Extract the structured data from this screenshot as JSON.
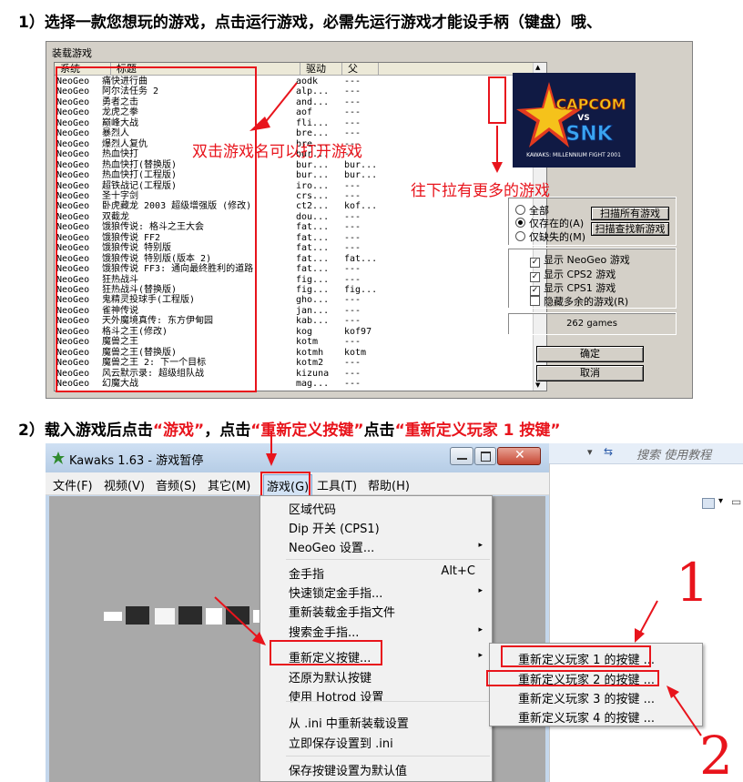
{
  "step1": {
    "number": "1）",
    "text": "选择一款您想玩的游戏，点击运行游戏，必需先运行游戏才能设手柄（键盘）哦、"
  },
  "loader": {
    "title": "装载游戏",
    "columns": {
      "system": "系统",
      "title": "标题",
      "driver": "驱动",
      "parent": "父"
    },
    "games": [
      {
        "system": "NeoGeo",
        "title": "痛快进行曲",
        "driver": "aodk",
        "parent": "---"
      },
      {
        "system": "NeoGeo",
        "title": "阿尔法任务 2",
        "driver": "alp...",
        "parent": "---"
      },
      {
        "system": "NeoGeo",
        "title": "勇者之击",
        "driver": "and...",
        "parent": "---"
      },
      {
        "system": "NeoGeo",
        "title": "龙虎之拳",
        "driver": "aof",
        "parent": "---"
      },
      {
        "system": "NeoGeo",
        "title": "巅峰大战",
        "driver": "fli...",
        "parent": "---"
      },
      {
        "system": "NeoGeo",
        "title": "暴烈人",
        "driver": "bre...",
        "parent": "---"
      },
      {
        "system": "NeoGeo",
        "title": "爆烈人复仇",
        "driver": "bre...",
        "parent": "---"
      },
      {
        "system": "NeoGeo",
        "title": "热血快打",
        "driver": "bur...",
        "parent": "---"
      },
      {
        "system": "NeoGeo",
        "title": "热血快打(替换版)",
        "driver": "bur...",
        "parent": "bur..."
      },
      {
        "system": "NeoGeo",
        "title": "热血快打(工程版)",
        "driver": "bur...",
        "parent": "bur..."
      },
      {
        "system": "NeoGeo",
        "title": "超铁战记(工程版)",
        "driver": "iro...",
        "parent": "---"
      },
      {
        "system": "NeoGeo",
        "title": "圣十字剑",
        "driver": "crs...",
        "parent": "---"
      },
      {
        "system": "NeoGeo",
        "title": "卧虎藏龙 2003 超级增强版 (修改)",
        "driver": "ct2...",
        "parent": "kof..."
      },
      {
        "system": "NeoGeo",
        "title": "双截龙",
        "driver": "dou...",
        "parent": "---"
      },
      {
        "system": "NeoGeo",
        "title": "饿狼传说: 格斗之王大会",
        "driver": "fat...",
        "parent": "---"
      },
      {
        "system": "NeoGeo",
        "title": "饿狼传说 FF2",
        "driver": "fat...",
        "parent": "---"
      },
      {
        "system": "NeoGeo",
        "title": "饿狼传说 特别版",
        "driver": "fat...",
        "parent": "---"
      },
      {
        "system": "NeoGeo",
        "title": "饿狼传说 特别版(版本 2)",
        "driver": "fat...",
        "parent": "fat..."
      },
      {
        "system": "NeoGeo",
        "title": "饿狼传说 FF3: 通向最终胜利的道路",
        "driver": "fat...",
        "parent": "---"
      },
      {
        "system": "NeoGeo",
        "title": "狂热战斗",
        "driver": "fig...",
        "parent": "---"
      },
      {
        "system": "NeoGeo",
        "title": "狂热战斗(替换版)",
        "driver": "fig...",
        "parent": "fig..."
      },
      {
        "system": "NeoGeo",
        "title": "鬼精灵投球手(工程版)",
        "driver": "gho...",
        "parent": "---"
      },
      {
        "system": "NeoGeo",
        "title": "雀神传说",
        "driver": "jan...",
        "parent": "---"
      },
      {
        "system": "NeoGeo",
        "title": "天外魔境真传: 东方伊甸园",
        "driver": "kab...",
        "parent": "---"
      },
      {
        "system": "NeoGeo",
        "title": "格斗之王(修改)",
        "driver": "kog",
        "parent": "kof97"
      },
      {
        "system": "NeoGeo",
        "title": "魔兽之王",
        "driver": "kotm",
        "parent": "---"
      },
      {
        "system": "NeoGeo",
        "title": "魔兽之王(替换版)",
        "driver": "kotmh",
        "parent": "kotm"
      },
      {
        "system": "NeoGeo",
        "title": "魔兽之王 2: 下一个目标",
        "driver": "kotm2",
        "parent": "---"
      },
      {
        "system": "NeoGeo",
        "title": "风云默示录: 超级组队战",
        "driver": "kizuna",
        "parent": "---"
      },
      {
        "system": "NeoGeo",
        "title": "幻魔大战",
        "driver": "mag...",
        "parent": "---"
      }
    ],
    "logo": {
      "line1": "CAPCOM",
      "vs": "VS",
      "line2": "SNK",
      "sub": "KAWAKS: MILLENNIUM FIGHT 2001"
    },
    "filter": {
      "all": "全部",
      "available": "仅存在的(A)",
      "missing": "仅缺失的(M)",
      "scan_all": "扫描所有游戏",
      "scan_new": "扫描查找新游戏"
    },
    "show": {
      "neogeo": "显示 NeoGeo 游戏",
      "cps2": "显示 CPS2 游戏",
      "cps1": "显示 CPS1 游戏",
      "hide_clones": "隐藏多余的游戏(R)"
    },
    "game_count": "262 games",
    "ok": "确定",
    "cancel": "取消",
    "hint_dblclick": "双击游戏名可以打开游戏",
    "hint_scroll": "往下拉有更多的游戏"
  },
  "step2": {
    "number": "2）",
    "p1": "载入游戏后点击",
    "q1": "“游戏”",
    "p2": "，点击",
    "q2": "“重新定义按键”",
    "p3": "点击",
    "q3": "“重新定义玩家 1 按键”"
  },
  "kawaks": {
    "title": "Kawaks 1.63 - 游戏暂停",
    "menus": [
      "文件(F)",
      "视频(V)",
      "音频(S)",
      "其它(M)",
      "游戏(G)",
      "工具(T)",
      "帮助(H)"
    ],
    "game_menu": [
      {
        "label": "区域代码"
      },
      {
        "label": "Dip 开关 (CPS1)"
      },
      {
        "label": "NeoGeo 设置...",
        "arrow": "▸"
      },
      {
        "label": "金手指",
        "accel": "Alt+C"
      },
      {
        "label": "快速锁定金手指...",
        "arrow": "▸"
      },
      {
        "label": "重新装载金手指文件"
      },
      {
        "label": "搜索金手指...",
        "arrow": "▸"
      },
      {
        "label": "重新定义按键...",
        "arrow": "▸"
      },
      {
        "label": "还原为默认按键"
      },
      {
        "label": "使用 Hotrod 设置"
      },
      {
        "label": "从 .ini 中重新装载设置"
      },
      {
        "label": "立即保存设置到 .ini"
      },
      {
        "label": "保存按键设置为默认值"
      }
    ],
    "submenu": [
      "重新定义玩家 1 的按键 ...",
      "重新定义玩家 2 的按键 ...",
      "重新定义玩家 3 的按键 ...",
      "重新定义玩家 4 的按键 ..."
    ],
    "annot_1": "1",
    "annot_2": "2"
  },
  "explorer": {
    "search_placeholder": "搜索 使用教程"
  },
  "colors": {
    "annotation_red": "#e8141c",
    "menu_bg": "#f1f1f1",
    "dialog_bg": "#d4d0c8"
  }
}
